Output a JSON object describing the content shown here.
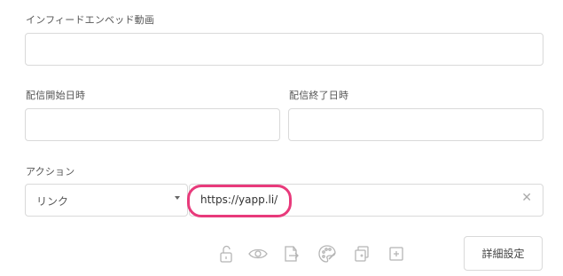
{
  "form": {
    "video_label": "インフィードエンベッド動画",
    "video_value": "",
    "start_label": "配信開始日時",
    "start_value": "",
    "end_label": "配信終了日時",
    "end_value": "",
    "action_label": "アクション",
    "action_select": "リンク",
    "action_url": "https://yapp.li/",
    "clear_glyph": "✕"
  },
  "toolbar": {
    "icons": [
      "lock-open-icon",
      "eye-icon",
      "export-icon",
      "palette-icon",
      "duplicate-icon",
      "add-icon"
    ],
    "detail_button": "詳細設定"
  },
  "colors": {
    "highlight": "#e83a7b",
    "border": "#d9d9d9"
  }
}
